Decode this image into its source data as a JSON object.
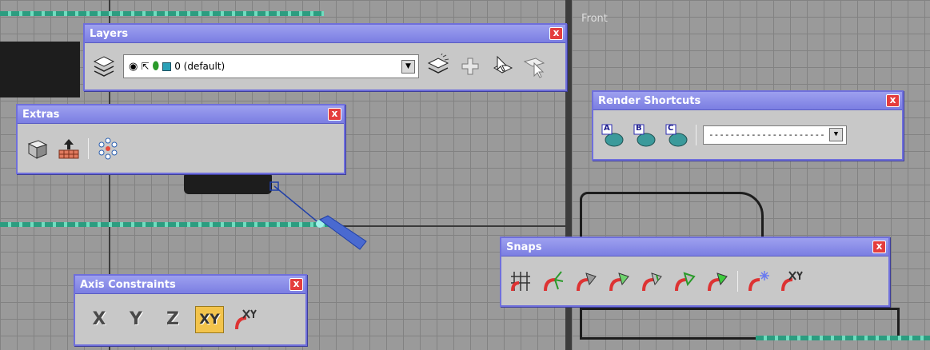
{
  "viewports": {
    "right_label": "Front"
  },
  "colors": {
    "title_bar": "#7b7ee2",
    "toolbar_bg": "#c8c8c8",
    "close": "#e43d3d",
    "active_axis": "#f3c44c",
    "grid": "#9a9a9a"
  },
  "layers": {
    "title": "Layers",
    "close_label": "x",
    "current_layer": "0 (default)",
    "dropdown_arrow": "▼"
  },
  "extras": {
    "title": "Extras",
    "close_label": "x"
  },
  "render_shortcuts": {
    "title": "Render Shortcuts",
    "close_label": "x",
    "preset_labels": [
      "A",
      "B",
      "C"
    ],
    "preset_value": "------------------------------",
    "dropdown_arrow": "▼"
  },
  "snaps": {
    "title": "Snaps",
    "close_label": "x"
  },
  "axis_constraints": {
    "title": "Axis Constraints",
    "close_label": "x",
    "buttons": [
      "X",
      "Y",
      "Z",
      "XY"
    ],
    "active": "XY"
  }
}
